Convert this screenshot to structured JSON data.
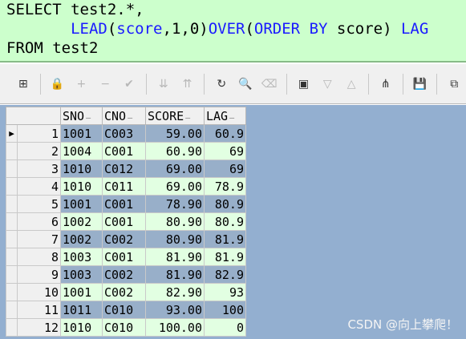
{
  "sql": {
    "line1": "SELECT test2.*,",
    "line2": "       LEAD(score,1,0)OVER(ORDER BY score) LAG",
    "line3": "FROM test2"
  },
  "toolbar": {
    "buttons": [
      {
        "name": "grid-menu-icon",
        "glyph": "⊞",
        "enabled": true
      },
      {
        "name": "lock-icon",
        "glyph": "🔒",
        "enabled": true
      },
      {
        "name": "add-record-icon",
        "glyph": "+",
        "enabled": false
      },
      {
        "name": "delete-record-icon",
        "glyph": "−",
        "enabled": false
      },
      {
        "name": "post-record-icon",
        "glyph": "✔",
        "enabled": false
      },
      {
        "name": "first-record-icon",
        "glyph": "⇊",
        "enabled": false
      },
      {
        "name": "last-record-icon",
        "glyph": "⇈",
        "enabled": false
      },
      {
        "name": "refresh-icon",
        "glyph": "↻",
        "enabled": true
      },
      {
        "name": "find-icon",
        "glyph": "🔍",
        "enabled": true
      },
      {
        "name": "clear-icon",
        "glyph": "⌫",
        "enabled": false
      },
      {
        "name": "query-by-example-icon",
        "glyph": "▣",
        "enabled": true
      },
      {
        "name": "previous-icon",
        "glyph": "▽",
        "enabled": false
      },
      {
        "name": "next-icon",
        "glyph": "△",
        "enabled": false
      },
      {
        "name": "tree-icon",
        "glyph": "⋔",
        "enabled": true
      },
      {
        "name": "save-icon",
        "glyph": "💾",
        "enabled": true
      },
      {
        "name": "export-icon",
        "glyph": "⧉",
        "enabled": true
      }
    ]
  },
  "grid": {
    "columns": [
      "SNO",
      "CNO",
      "SCORE",
      "LAG"
    ],
    "rows": [
      {
        "num": "1",
        "sno": "1001",
        "cno": "C003",
        "score": "59.00",
        "lag": "60.9",
        "current": true
      },
      {
        "num": "2",
        "sno": "1004",
        "cno": "C001",
        "score": "60.90",
        "lag": "69"
      },
      {
        "num": "3",
        "sno": "1010",
        "cno": "C012",
        "score": "69.00",
        "lag": "69"
      },
      {
        "num": "4",
        "sno": "1010",
        "cno": "C011",
        "score": "69.00",
        "lag": "78.9"
      },
      {
        "num": "5",
        "sno": "1001",
        "cno": "C001",
        "score": "78.90",
        "lag": "80.9"
      },
      {
        "num": "6",
        "sno": "1002",
        "cno": "C001",
        "score": "80.90",
        "lag": "80.9"
      },
      {
        "num": "7",
        "sno": "1002",
        "cno": "C002",
        "score": "80.90",
        "lag": "81.9"
      },
      {
        "num": "8",
        "sno": "1003",
        "cno": "C001",
        "score": "81.90",
        "lag": "81.9"
      },
      {
        "num": "9",
        "sno": "1003",
        "cno": "C002",
        "score": "81.90",
        "lag": "82.9"
      },
      {
        "num": "10",
        "sno": "1001",
        "cno": "C002",
        "score": "82.90",
        "lag": "93"
      },
      {
        "num": "11",
        "sno": "1011",
        "cno": "C010",
        "score": "93.00",
        "lag": "100"
      },
      {
        "num": "12",
        "sno": "1010",
        "cno": "C010",
        "score": "100.00",
        "lag": "0"
      }
    ]
  },
  "watermark": "CSDN @向上攀爬！",
  "colors": {
    "editor_bg": "#ccffcc",
    "keyword": "#1a1aff",
    "row_a": "#98afc9",
    "row_b": "#e2ffe2",
    "grid_bg": "#93afd0"
  }
}
